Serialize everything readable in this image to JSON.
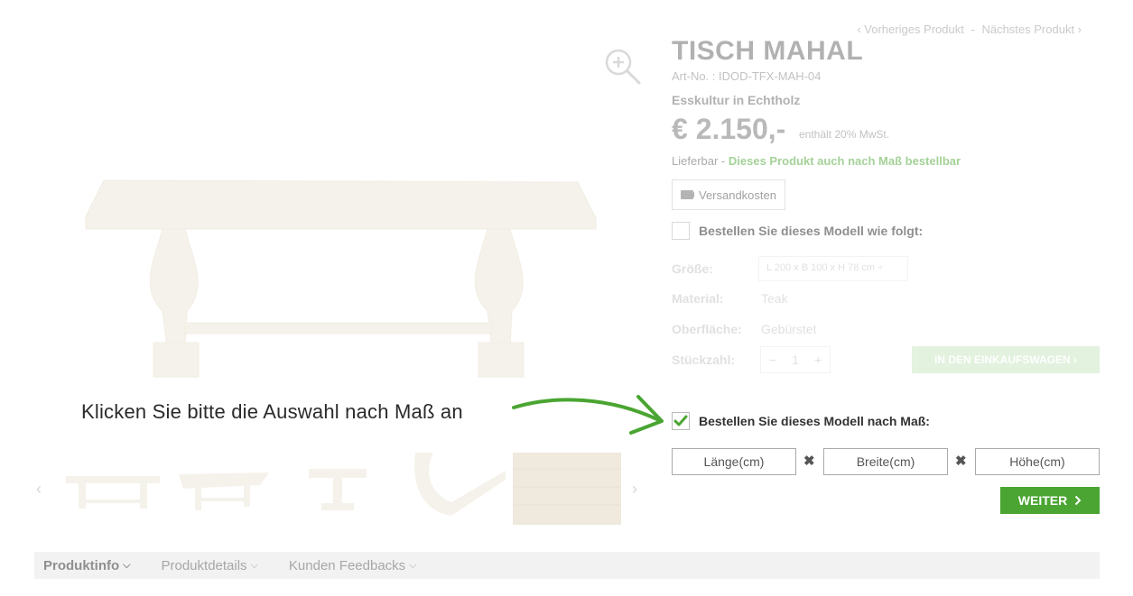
{
  "nav": {
    "prev": "‹ Vorheriges Produkt",
    "sep": "-",
    "next": "Nächstes Produkt ›"
  },
  "product": {
    "title": "TISCH MAHAL",
    "art_no": "Art-No. : IDOD-TFX-MAH-04",
    "subtitle": "Esskultur in Echtholz",
    "price": "€ 2.150,-",
    "vat": "enthält 20% MwSt.",
    "availability": "Lieferbar -",
    "custom_note": "Dieses Produkt auch nach Maß bestellbar"
  },
  "shipping": {
    "label": "Versandkosten",
    "icon": "truck-icon"
  },
  "option_standard": {
    "label": "Bestellen Sie dieses Modell wie folgt:"
  },
  "specs": {
    "size_label": "Größe:",
    "size_value": "L 200 x B 100 x H 78 cm ÷",
    "material_label": "Material:",
    "material_value": "Teak",
    "surface_label": "Oberfläche:",
    "surface_value": "Gebürstet",
    "qty_label": "Stückzahl:",
    "qty_minus": "−",
    "qty_value": "1",
    "qty_plus": "+",
    "cart_button": "IN DEN EINKAUFSWAGEN ›"
  },
  "instruction": "Klicken Sie bitte die Auswahl nach Maß an",
  "option_custom": {
    "label": "Bestellen Sie dieses Modell nach Maß:",
    "checked": true
  },
  "dimensions": {
    "length_placeholder": "Länge(cm)",
    "width_placeholder": "Breite(cm)",
    "height_placeholder": "Höhe(cm)",
    "times": "✖"
  },
  "continue_button": {
    "label": "WEITER",
    "icon": "chevron-right-icon"
  },
  "thumbs": {
    "prev": "‹",
    "next": "›"
  },
  "tabs": [
    {
      "label": "Produktinfo"
    },
    {
      "label": "Produktdetails"
    },
    {
      "label": "Kunden Feedbacks"
    }
  ],
  "colors": {
    "accent": "#4aa532",
    "tab_bar": "#f2f2f2"
  }
}
